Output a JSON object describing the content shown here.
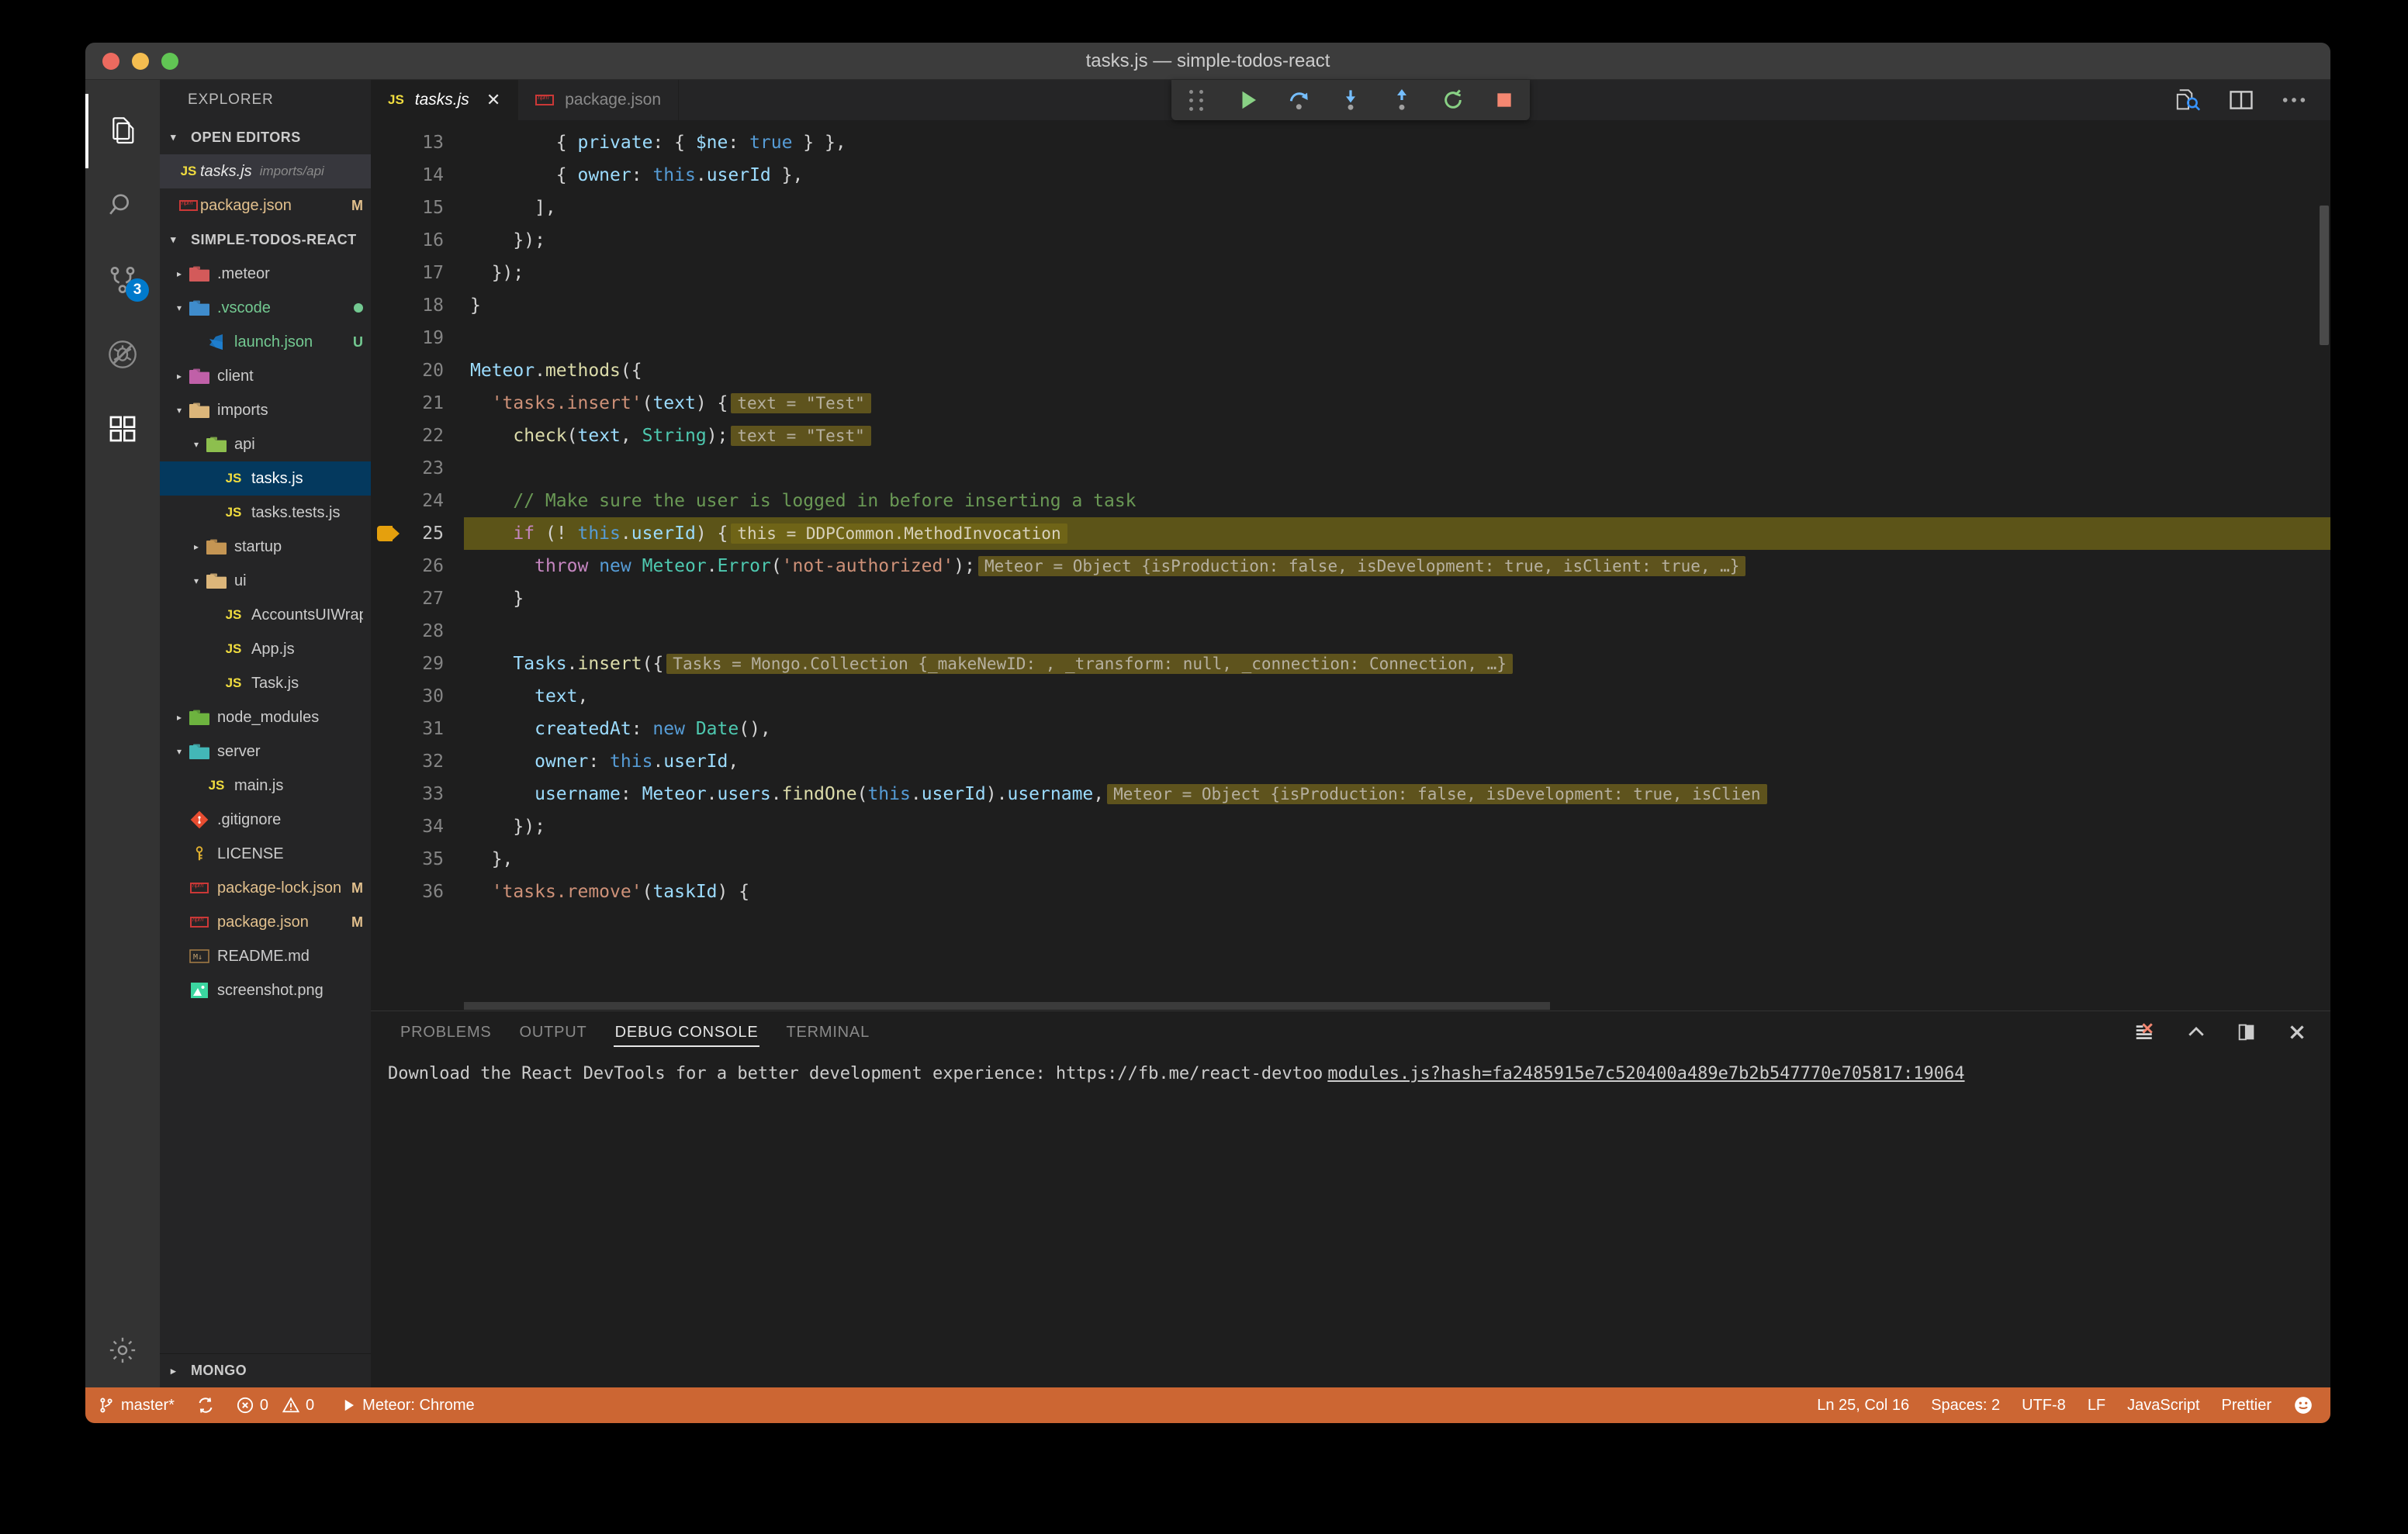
{
  "window": {
    "title": "tasks.js — simple-todos-react",
    "traffic_lights": [
      "close-red",
      "minimize-yellow",
      "zoom-green"
    ]
  },
  "activity_bar": {
    "items": [
      {
        "name": "explorer",
        "icon": "files-icon",
        "active": true,
        "badge": null
      },
      {
        "name": "search",
        "icon": "search-icon",
        "active": false,
        "badge": null
      },
      {
        "name": "source-control",
        "icon": "source-control-icon",
        "active": false,
        "badge": "3"
      },
      {
        "name": "debug",
        "icon": "debug-disabled-icon",
        "active": false,
        "badge": null
      },
      {
        "name": "extensions",
        "icon": "extensions-icon",
        "active": false,
        "badge": null
      },
      {
        "name": "settings",
        "icon": "gear-icon",
        "active": false,
        "badge": null
      }
    ]
  },
  "sidebar": {
    "title": "EXPLORER",
    "open_editors": {
      "label": "OPEN EDITORS",
      "expanded": true,
      "items": [
        {
          "icon": "js-icon",
          "name": "tasks.js",
          "sub": "imports/api",
          "mark": "",
          "selected": true,
          "italic": true
        },
        {
          "icon": "npm-icon",
          "name": "package.json",
          "sub": "",
          "mark": "M",
          "selected": false,
          "italic": false
        }
      ]
    },
    "project": {
      "label": "SIMPLE-TODOS-REACT",
      "expanded": true,
      "items": [
        {
          "depth": 0,
          "arrow": "collapsed",
          "icon": "folder-meteor",
          "name": ".meteor",
          "mark": "",
          "color": "#cccccc"
        },
        {
          "depth": 0,
          "arrow": "expanded",
          "icon": "folder-vscode",
          "name": ".vscode",
          "mark": "",
          "color": "#73c991",
          "dot": true
        },
        {
          "depth": 1,
          "arrow": "none",
          "icon": "vscode-file",
          "name": "launch.json",
          "mark": "U",
          "color": "#73c991"
        },
        {
          "depth": 0,
          "arrow": "collapsed",
          "icon": "folder-client",
          "name": "client",
          "mark": "",
          "color": "#cccccc"
        },
        {
          "depth": 0,
          "arrow": "expanded",
          "icon": "folder-open",
          "name": "imports",
          "mark": "",
          "color": "#cccccc"
        },
        {
          "depth": 1,
          "arrow": "expanded",
          "icon": "folder-api",
          "name": "api",
          "mark": "",
          "color": "#cccccc"
        },
        {
          "depth": 2,
          "arrow": "none",
          "icon": "js-icon",
          "name": "tasks.js",
          "mark": "",
          "color": "#ffffff",
          "selected": true
        },
        {
          "depth": 2,
          "arrow": "none",
          "icon": "js-icon",
          "name": "tasks.tests.js",
          "mark": "",
          "color": "#cccccc"
        },
        {
          "depth": 1,
          "arrow": "collapsed",
          "icon": "folder-plain",
          "name": "startup",
          "mark": "",
          "color": "#cccccc"
        },
        {
          "depth": 1,
          "arrow": "expanded",
          "icon": "folder-open",
          "name": "ui",
          "mark": "",
          "color": "#cccccc"
        },
        {
          "depth": 2,
          "arrow": "none",
          "icon": "js-icon",
          "name": "AccountsUIWrapper.js",
          "mark": "",
          "color": "#cccccc"
        },
        {
          "depth": 2,
          "arrow": "none",
          "icon": "js-icon",
          "name": "App.js",
          "mark": "",
          "color": "#cccccc"
        },
        {
          "depth": 2,
          "arrow": "none",
          "icon": "js-icon",
          "name": "Task.js",
          "mark": "",
          "color": "#cccccc"
        },
        {
          "depth": 0,
          "arrow": "collapsed",
          "icon": "folder-node",
          "name": "node_modules",
          "mark": "",
          "color": "#cccccc"
        },
        {
          "depth": 0,
          "arrow": "expanded",
          "icon": "folder-server",
          "name": "server",
          "mark": "",
          "color": "#cccccc"
        },
        {
          "depth": 1,
          "arrow": "none",
          "icon": "js-icon",
          "name": "main.js",
          "mark": "",
          "color": "#cccccc"
        },
        {
          "depth": 0,
          "arrow": "none",
          "icon": "git-icon",
          "name": ".gitignore",
          "mark": "",
          "color": "#cccccc"
        },
        {
          "depth": 0,
          "arrow": "none",
          "icon": "license-icon",
          "name": "LICENSE",
          "mark": "",
          "color": "#cccccc"
        },
        {
          "depth": 0,
          "arrow": "none",
          "icon": "npm-icon",
          "name": "package-lock.json",
          "mark": "M",
          "color": "#e2c08d"
        },
        {
          "depth": 0,
          "arrow": "none",
          "icon": "npm-icon",
          "name": "package.json",
          "mark": "M",
          "color": "#e2c08d"
        },
        {
          "depth": 0,
          "arrow": "none",
          "icon": "markdown-icon",
          "name": "README.md",
          "mark": "",
          "color": "#cccccc"
        },
        {
          "depth": 0,
          "arrow": "none",
          "icon": "image-icon",
          "name": "screenshot.png",
          "mark": "",
          "color": "#cccccc"
        }
      ]
    },
    "mongo_section": {
      "label": "MONGO",
      "expanded": false
    }
  },
  "editor": {
    "tabs": [
      {
        "icon": "js-icon",
        "label": "tasks.js",
        "active": true,
        "dirty": false,
        "close_glyph": "✕"
      },
      {
        "icon": "npm-icon",
        "label": "package.json",
        "active": false,
        "dirty": false,
        "close_glyph": ""
      }
    ],
    "toolbar_icons": [
      "open-changes-icon",
      "split-editor-icon",
      "more-actions-icon"
    ],
    "debug_toolbar": {
      "icons": [
        "drag-grip",
        "continue-icon",
        "step-over-icon",
        "step-into-icon",
        "step-out-icon",
        "restart-icon",
        "stop-icon"
      ]
    },
    "cursor": {
      "line": 25,
      "column": 16
    },
    "lines": [
      {
        "n": 13,
        "breakpoint": false,
        "current": false,
        "tokens": [
          {
            "t": "        { ",
            "c": "punc"
          },
          {
            "t": "private",
            "c": "var"
          },
          {
            "t": ": { ",
            "c": "punc"
          },
          {
            "t": "$ne",
            "c": "var"
          },
          {
            "t": ": ",
            "c": "punc"
          },
          {
            "t": "true",
            "c": "kw2"
          },
          {
            "t": " } },",
            "c": "punc"
          }
        ],
        "inline": null
      },
      {
        "n": 14,
        "breakpoint": false,
        "current": false,
        "tokens": [
          {
            "t": "        { ",
            "c": "punc"
          },
          {
            "t": "owner",
            "c": "var"
          },
          {
            "t": ": ",
            "c": "punc"
          },
          {
            "t": "this",
            "c": "kw2"
          },
          {
            "t": ".",
            "c": "punc"
          },
          {
            "t": "userId",
            "c": "var"
          },
          {
            "t": " },",
            "c": "punc"
          }
        ],
        "inline": null
      },
      {
        "n": 15,
        "breakpoint": false,
        "current": false,
        "tokens": [
          {
            "t": "      ],",
            "c": "punc"
          }
        ],
        "inline": null
      },
      {
        "n": 16,
        "breakpoint": false,
        "current": false,
        "tokens": [
          {
            "t": "    });",
            "c": "punc"
          }
        ],
        "inline": null
      },
      {
        "n": 17,
        "breakpoint": false,
        "current": false,
        "tokens": [
          {
            "t": "  });",
            "c": "punc"
          }
        ],
        "inline": null
      },
      {
        "n": 18,
        "breakpoint": false,
        "current": false,
        "tokens": [
          {
            "t": "}",
            "c": "punc"
          }
        ],
        "inline": null
      },
      {
        "n": 19,
        "breakpoint": false,
        "current": false,
        "tokens": [],
        "inline": null
      },
      {
        "n": 20,
        "breakpoint": false,
        "current": false,
        "tokens": [
          {
            "t": "Meteor",
            "c": "var"
          },
          {
            "t": ".",
            "c": "punc"
          },
          {
            "t": "methods",
            "c": "fn"
          },
          {
            "t": "({",
            "c": "punc"
          }
        ],
        "inline": null
      },
      {
        "n": 21,
        "breakpoint": false,
        "current": false,
        "tokens": [
          {
            "t": "  ",
            "c": "punc"
          },
          {
            "t": "'tasks.insert'",
            "c": "str"
          },
          {
            "t": "(",
            "c": "punc"
          },
          {
            "t": "text",
            "c": "var"
          },
          {
            "t": ") {",
            "c": "punc"
          }
        ],
        "inline": "text = \"Test\""
      },
      {
        "n": 22,
        "breakpoint": false,
        "current": false,
        "tokens": [
          {
            "t": "    ",
            "c": "punc"
          },
          {
            "t": "check",
            "c": "fn"
          },
          {
            "t": "(",
            "c": "punc"
          },
          {
            "t": "text",
            "c": "var"
          },
          {
            "t": ", ",
            "c": "punc"
          },
          {
            "t": "String",
            "c": "cls"
          },
          {
            "t": ");",
            "c": "punc"
          }
        ],
        "inline": "text = \"Test\""
      },
      {
        "n": 23,
        "breakpoint": false,
        "current": false,
        "tokens": [],
        "inline": null
      },
      {
        "n": 24,
        "breakpoint": false,
        "current": false,
        "tokens": [
          {
            "t": "    // Make sure the user is logged in before inserting a task",
            "c": "com"
          }
        ],
        "inline": null
      },
      {
        "n": 25,
        "breakpoint": true,
        "current": true,
        "tokens": [
          {
            "t": "    ",
            "c": "punc"
          },
          {
            "t": "if",
            "c": "kw"
          },
          {
            "t": " (! ",
            "c": "punc"
          },
          {
            "t": "this",
            "c": "kw2"
          },
          {
            "t": ".",
            "c": "punc"
          },
          {
            "t": "userId",
            "c": "var"
          },
          {
            "t": ") {",
            "c": "punc"
          }
        ],
        "inline": "this = DDPCommon.MethodInvocation"
      },
      {
        "n": 26,
        "breakpoint": false,
        "current": false,
        "tokens": [
          {
            "t": "      ",
            "c": "punc"
          },
          {
            "t": "throw",
            "c": "kw"
          },
          {
            "t": " ",
            "c": "punc"
          },
          {
            "t": "new",
            "c": "kw2"
          },
          {
            "t": " ",
            "c": "punc"
          },
          {
            "t": "Meteor",
            "c": "cls"
          },
          {
            "t": ".",
            "c": "punc"
          },
          {
            "t": "Error",
            "c": "cls"
          },
          {
            "t": "(",
            "c": "punc"
          },
          {
            "t": "'not-authorized'",
            "c": "str"
          },
          {
            "t": ");",
            "c": "punc"
          }
        ],
        "inline": "Meteor = Object {isProduction: false, isDevelopment: true, isClient: true, …}"
      },
      {
        "n": 27,
        "breakpoint": false,
        "current": false,
        "tokens": [
          {
            "t": "    }",
            "c": "punc"
          }
        ],
        "inline": null
      },
      {
        "n": 28,
        "breakpoint": false,
        "current": false,
        "tokens": [],
        "inline": null
      },
      {
        "n": 29,
        "breakpoint": false,
        "current": false,
        "tokens": [
          {
            "t": "    ",
            "c": "punc"
          },
          {
            "t": "Tasks",
            "c": "var"
          },
          {
            "t": ".",
            "c": "punc"
          },
          {
            "t": "insert",
            "c": "fn"
          },
          {
            "t": "({",
            "c": "punc"
          }
        ],
        "inline": "Tasks = Mongo.Collection {_makeNewID: , _transform: null, _connection: Connection, …}"
      },
      {
        "n": 30,
        "breakpoint": false,
        "current": false,
        "tokens": [
          {
            "t": "      ",
            "c": "punc"
          },
          {
            "t": "text",
            "c": "var"
          },
          {
            "t": ",",
            "c": "punc"
          }
        ],
        "inline": null
      },
      {
        "n": 31,
        "breakpoint": false,
        "current": false,
        "tokens": [
          {
            "t": "      ",
            "c": "punc"
          },
          {
            "t": "createdAt",
            "c": "var"
          },
          {
            "t": ": ",
            "c": "punc"
          },
          {
            "t": "new",
            "c": "kw2"
          },
          {
            "t": " ",
            "c": "punc"
          },
          {
            "t": "Date",
            "c": "cls"
          },
          {
            "t": "(),",
            "c": "punc"
          }
        ],
        "inline": null
      },
      {
        "n": 32,
        "breakpoint": false,
        "current": false,
        "tokens": [
          {
            "t": "      ",
            "c": "punc"
          },
          {
            "t": "owner",
            "c": "var"
          },
          {
            "t": ": ",
            "c": "punc"
          },
          {
            "t": "this",
            "c": "kw2"
          },
          {
            "t": ".",
            "c": "punc"
          },
          {
            "t": "userId",
            "c": "var"
          },
          {
            "t": ",",
            "c": "punc"
          }
        ],
        "inline": null
      },
      {
        "n": 33,
        "breakpoint": false,
        "current": false,
        "tokens": [
          {
            "t": "      ",
            "c": "punc"
          },
          {
            "t": "username",
            "c": "var"
          },
          {
            "t": ": ",
            "c": "punc"
          },
          {
            "t": "Meteor",
            "c": "var"
          },
          {
            "t": ".",
            "c": "punc"
          },
          {
            "t": "users",
            "c": "var"
          },
          {
            "t": ".",
            "c": "punc"
          },
          {
            "t": "findOne",
            "c": "fn"
          },
          {
            "t": "(",
            "c": "punc"
          },
          {
            "t": "this",
            "c": "kw2"
          },
          {
            "t": ".",
            "c": "punc"
          },
          {
            "t": "userId",
            "c": "var"
          },
          {
            "t": ").",
            "c": "punc"
          },
          {
            "t": "username",
            "c": "var"
          },
          {
            "t": ",",
            "c": "punc"
          }
        ],
        "inline": "Meteor = Object {isProduction: false, isDevelopment: true, isClien"
      },
      {
        "n": 34,
        "breakpoint": false,
        "current": false,
        "tokens": [
          {
            "t": "    });",
            "c": "punc"
          }
        ],
        "inline": null
      },
      {
        "n": 35,
        "breakpoint": false,
        "current": false,
        "tokens": [
          {
            "t": "  },",
            "c": "punc"
          }
        ],
        "inline": null
      },
      {
        "n": 36,
        "breakpoint": false,
        "current": false,
        "tokens": [
          {
            "t": "  ",
            "c": "punc"
          },
          {
            "t": "'tasks.remove'",
            "c": "str"
          },
          {
            "t": "(",
            "c": "punc"
          },
          {
            "t": "taskId",
            "c": "var"
          },
          {
            "t": ") {",
            "c": "punc"
          }
        ],
        "inline": null
      }
    ]
  },
  "panel": {
    "tabs": [
      {
        "label": "PROBLEMS",
        "active": false
      },
      {
        "label": "OUTPUT",
        "active": false
      },
      {
        "label": "DEBUG CONSOLE",
        "active": true
      },
      {
        "label": "TERMINAL",
        "active": false
      }
    ],
    "actions": [
      "clear-console-icon",
      "chevron-up-icon",
      "maximize-panel-icon",
      "close-panel-icon"
    ],
    "output": [
      {
        "text": "Download the React DevTools for a better development experience: https://fb.me/react-devtoo",
        "source": "modules.js?hash=fa2485915e7c520400a489e7b2b547770e705817:19064"
      }
    ]
  },
  "status_bar": {
    "left": [
      {
        "name": "branch",
        "icon": "source-control-icon",
        "label": "master*"
      },
      {
        "name": "sync",
        "icon": "sync-icon",
        "label": ""
      },
      {
        "name": "errors",
        "icon": "error-icon",
        "label": "0"
      },
      {
        "name": "warnings",
        "icon": "warning-icon",
        "label": "0"
      },
      {
        "name": "launch",
        "icon": "play-icon",
        "label": "Meteor: Chrome"
      }
    ],
    "right": [
      {
        "name": "cursor-position",
        "label": "Ln 25, Col 16"
      },
      {
        "name": "indentation",
        "label": "Spaces: 2"
      },
      {
        "name": "encoding",
        "label": "UTF-8"
      },
      {
        "name": "eol",
        "label": "LF"
      },
      {
        "name": "language-mode",
        "label": "JavaScript"
      },
      {
        "name": "prettier",
        "label": "Prettier"
      },
      {
        "name": "smiley",
        "label": "☺"
      }
    ]
  },
  "colors": {
    "status_bar_debug": "#cc6633",
    "accent_blue": "#007acc",
    "selection_blue": "#04395e",
    "inline_value_bg": "#5e531d",
    "exec_line_bg": "#5c5418"
  }
}
